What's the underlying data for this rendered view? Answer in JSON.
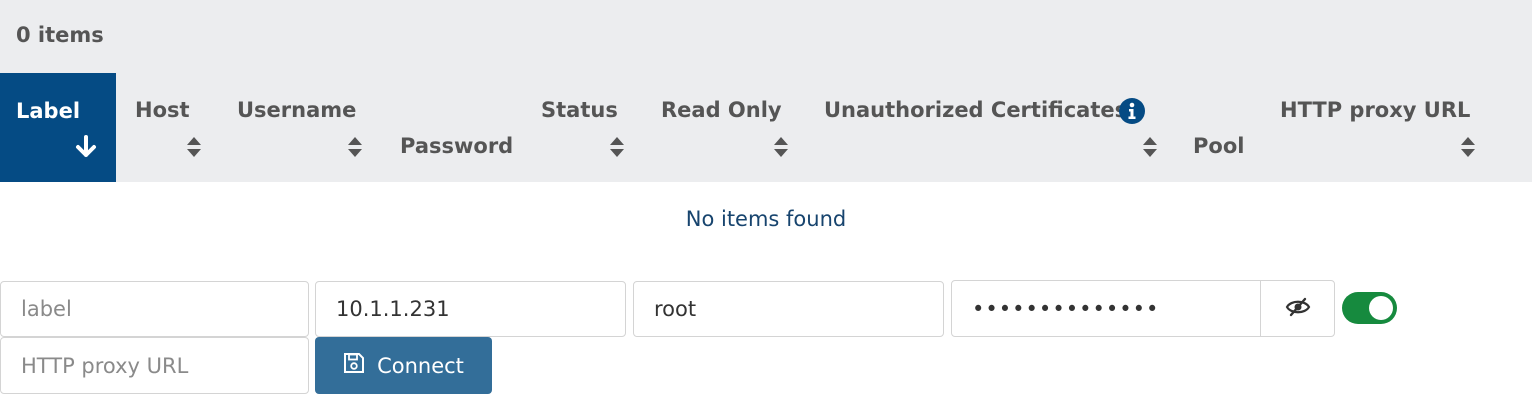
{
  "summary": {
    "count_text": "0 items"
  },
  "columns": [
    {
      "label": "Label",
      "sort": "desc",
      "active": true
    },
    {
      "label": "Host",
      "sort": "both"
    },
    {
      "label": "Username",
      "sort": "both"
    },
    {
      "label": "Password",
      "sort": "none"
    },
    {
      "label": "Status",
      "sort": "both"
    },
    {
      "label": "Read Only",
      "sort": "both"
    },
    {
      "label": "Unauthorized Certificates",
      "sort": "both",
      "info_icon": "info-circle-icon"
    },
    {
      "label": "Pool",
      "sort": "none"
    },
    {
      "label": "HTTP proxy URL",
      "sort": "both"
    }
  ],
  "table": {
    "empty_text": "No items found"
  },
  "form": {
    "label": {
      "value": "",
      "placeholder": "label"
    },
    "host": {
      "value": "10.1.1.231",
      "placeholder": ""
    },
    "username": {
      "value": "root",
      "placeholder": ""
    },
    "password": {
      "value": "••••••••••••••",
      "placeholder": ""
    },
    "proxy": {
      "value": "",
      "placeholder": "HTTP proxy URL"
    },
    "toggle": {
      "checked": true,
      "color": "#168a3e"
    },
    "connect_label": "Connect"
  },
  "colors": {
    "active_header": "#054b84",
    "connect_button": "#336e99",
    "empty_text": "#17446e"
  },
  "icons": {
    "sort_desc": "arrow-down-icon",
    "sort_both": "sort-icon",
    "password_toggle": "eye-slash-icon",
    "connect": "save-icon"
  }
}
